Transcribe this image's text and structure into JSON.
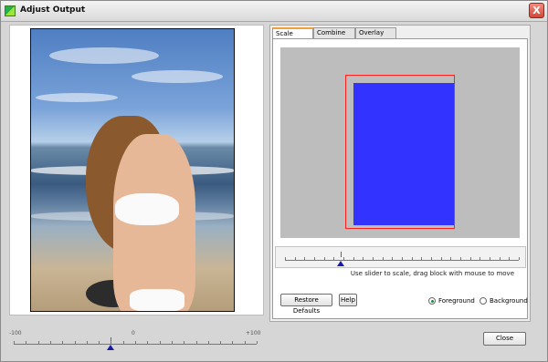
{
  "window": {
    "title": "Adjust Output",
    "close_glyph": "X"
  },
  "tabs": [
    {
      "label": "Scale",
      "active": true
    },
    {
      "label": "Combine",
      "active": false
    },
    {
      "label": "Overlay",
      "active": false
    }
  ],
  "scale_panel": {
    "hint": "Use slider to scale,  drag block with mouse to move",
    "restore_defaults_label": "Restore Defaults",
    "help_label": "Help",
    "radio_foreground_label": "Foreground",
    "radio_background_label": "Background",
    "selected_layer": "Foreground",
    "slider_position": 0.24,
    "colors": {
      "foreground_block": "#3333ff",
      "background_outline": "#ff2020",
      "canvas": "#bdbdbd"
    }
  },
  "bottom_slider": {
    "min_label": "-100",
    "mid_label": "0",
    "max_label": "+100",
    "value": -20
  },
  "footer": {
    "close_label": "Close"
  }
}
